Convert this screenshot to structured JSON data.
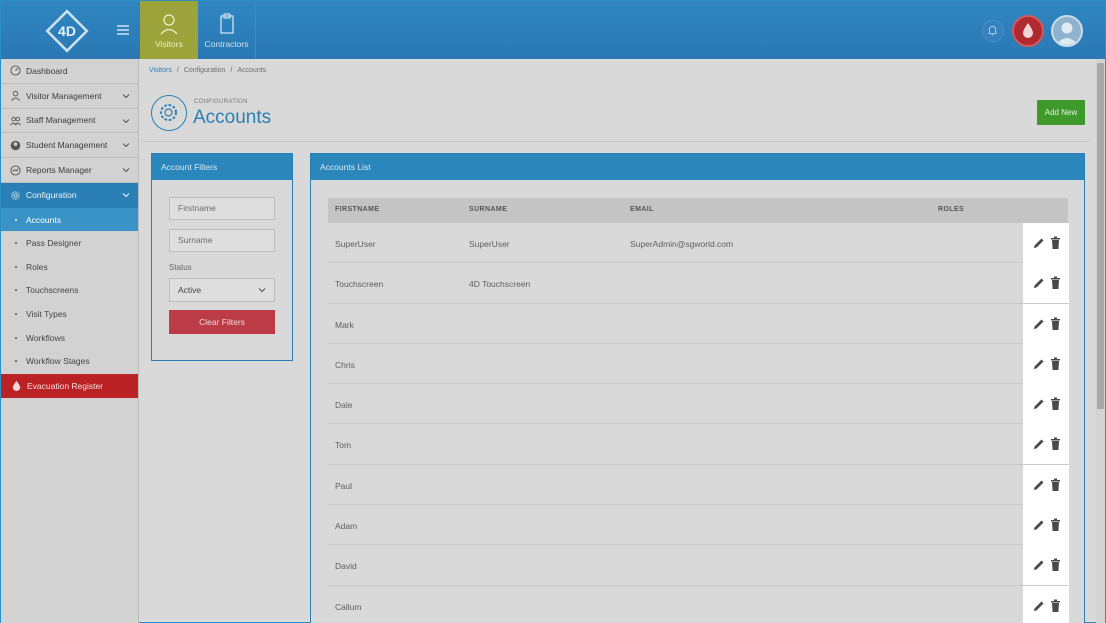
{
  "colors": {
    "brand": "#2a7fb4",
    "visitors_tab": "#9ca33a",
    "danger": "#bb2226",
    "add": "#3f9a2c"
  },
  "header": {
    "logo_text": "4D",
    "tabs": [
      {
        "label": "Visitors",
        "icon": "person-icon"
      },
      {
        "label": "Contractors",
        "icon": "clipboard-icon"
      }
    ]
  },
  "sidebar": {
    "items": [
      {
        "label": "Dashboard",
        "icon": "dashboard-icon"
      },
      {
        "label": "Visitor Management",
        "icon": "person-icon"
      },
      {
        "label": "Staff Management",
        "icon": "group-icon"
      },
      {
        "label": "Student Management",
        "icon": "student-icon"
      },
      {
        "label": "Reports Manager",
        "icon": "reports-icon"
      },
      {
        "label": "Configuration",
        "icon": "gear-icon"
      }
    ],
    "subitems": [
      "Accounts",
      "Pass Designer",
      "Roles",
      "Touchscreens",
      "Visit Types",
      "Workflows",
      "Workflow Stages"
    ],
    "evacuation": "Evacuation Register"
  },
  "breadcrumb": [
    "Visitors",
    "Configuration",
    "Accounts"
  ],
  "page": {
    "subtitle": "CONFIGURATION",
    "title": "Accounts",
    "add_label": "Add New"
  },
  "filters": {
    "title": "Account Filters",
    "firstname_placeholder": "Firstname",
    "surname_placeholder": "Surname",
    "status_label": "Status",
    "status_value": "Active",
    "clear_label": "Clear Filters"
  },
  "accounts": {
    "title": "Accounts List",
    "columns": [
      "FIRSTNAME",
      "SURNAME",
      "EMAIL",
      "ROLES"
    ],
    "rows": [
      {
        "firstname": "SuperUser",
        "surname": "SuperUser",
        "email": "SuperAdmin@sgworld.com",
        "roles": ""
      },
      {
        "firstname": "Touchscreen",
        "surname": "4D Touchscreen",
        "email": "",
        "roles": ""
      },
      {
        "firstname": "Mark",
        "surname": "",
        "email": "",
        "roles": ""
      },
      {
        "firstname": "Chris",
        "surname": "",
        "email": "",
        "roles": ""
      },
      {
        "firstname": "Dale",
        "surname": "",
        "email": "",
        "roles": ""
      },
      {
        "firstname": "Tom",
        "surname": "",
        "email": "",
        "roles": ""
      },
      {
        "firstname": "Paul",
        "surname": "",
        "email": "",
        "roles": ""
      },
      {
        "firstname": "Adam",
        "surname": "",
        "email": "",
        "roles": ""
      },
      {
        "firstname": "David",
        "surname": "",
        "email": "",
        "roles": ""
      },
      {
        "firstname": "Callum",
        "surname": "",
        "email": "",
        "roles": ""
      }
    ]
  }
}
